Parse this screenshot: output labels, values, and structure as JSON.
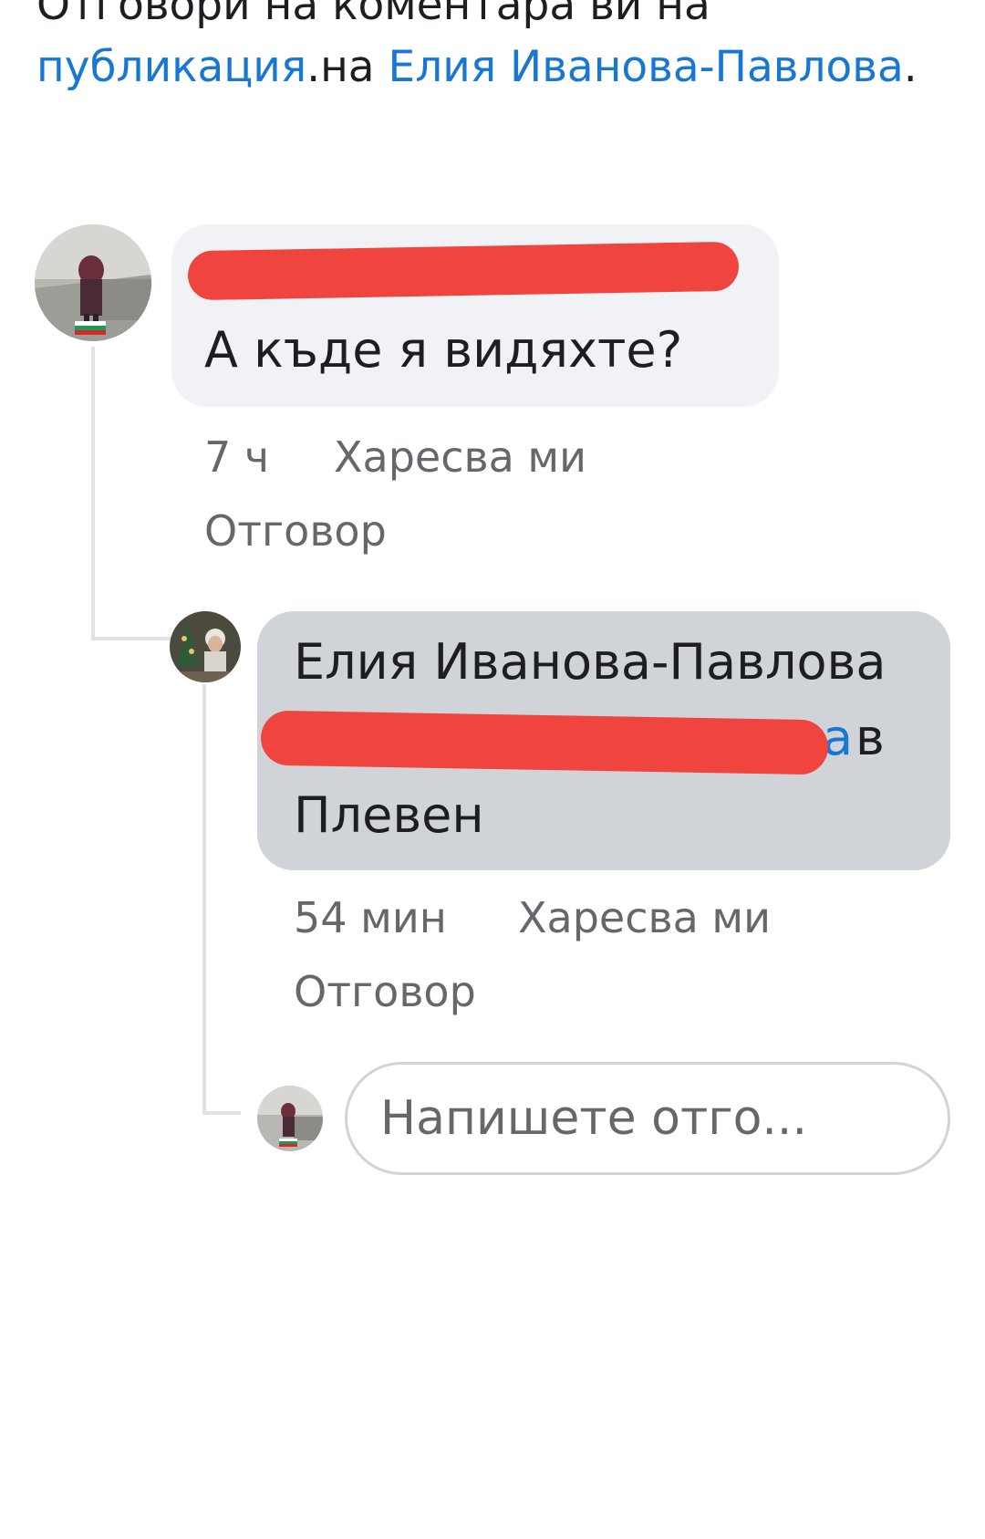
{
  "header": {
    "prefix": "Отговори на коментара ви на ",
    "post_link": "публикация",
    "middle": ".на ",
    "author_link": "Елия Иванова-Павлова",
    "suffix": "."
  },
  "comment": {
    "text": "А къде я видяхте?",
    "time": "7 ч",
    "like_label": "Харесва ми",
    "reply_label": "Отговор"
  },
  "reply": {
    "author": "Елия Иванова-Павлова",
    "mention_tail": "а",
    "text_after_mention": " в",
    "text_line2": "Плевен",
    "time": "54 мин",
    "like_label": "Харесва ми",
    "reply_label": "Отговор"
  },
  "composer": {
    "placeholder": "Напишете отго..."
  },
  "colors": {
    "link": "#1877d2",
    "bubble_light": "#f0f2f5",
    "bubble_highlight": "#d0d3d8",
    "redaction": "#f0443f"
  }
}
